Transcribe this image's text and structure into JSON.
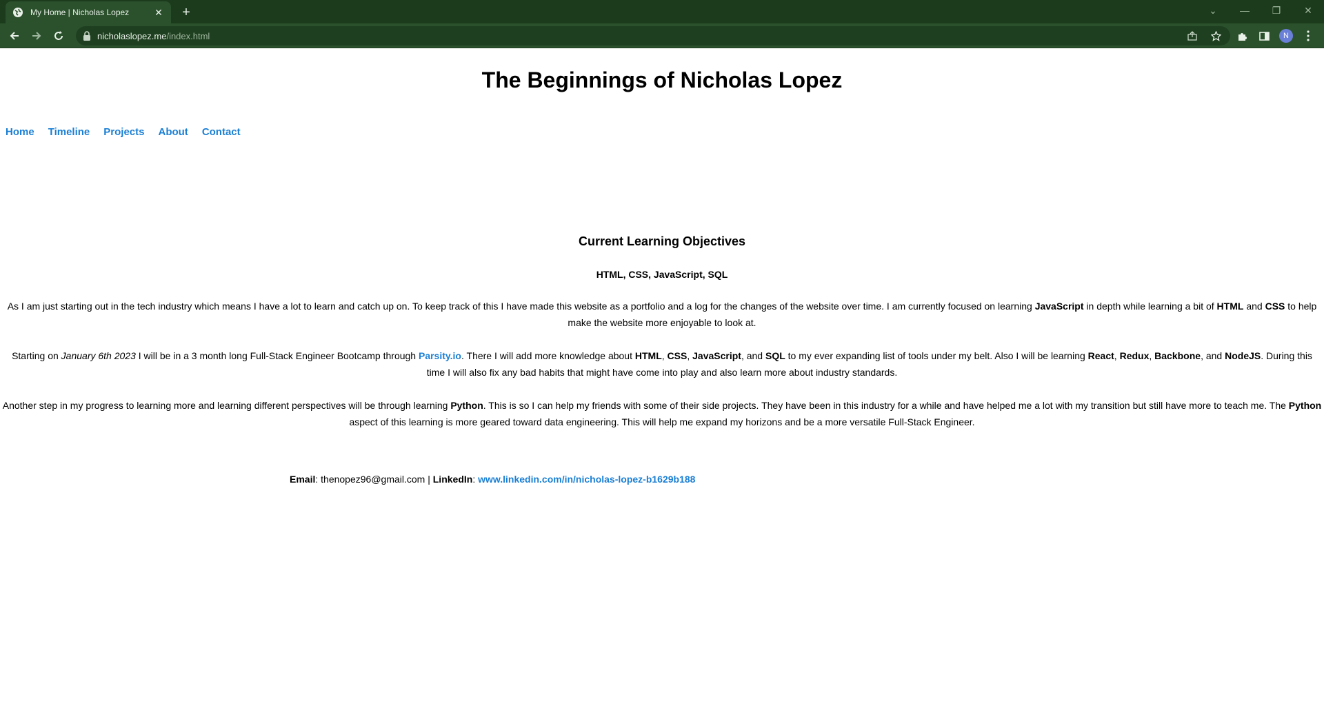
{
  "browser": {
    "tab_title": "My Home | Nicholas Lopez",
    "url_host": "nicholaslopez.me",
    "url_path": "/index.html",
    "profile_initial": "N",
    "theme_color": "#2b512c"
  },
  "site": {
    "title": "The Beginnings of Nicholas Lopez",
    "nav": [
      "Home",
      "Timeline",
      "Projects",
      "About",
      "Contact"
    ],
    "link_color": "#1a7fd4"
  },
  "objectives": {
    "heading": "Current Learning Objectives",
    "skills": "HTML, CSS, JavaScript, SQL",
    "p1": {
      "t1": "As I am just starting out in the tech industry which means I have a lot to learn and catch up on. To keep track of this I have made this website as a portfolio and a log for the changes of the website over time. I am currently focused on learning ",
      "b1": "JavaScript",
      "t2": " in depth while learning a bit of ",
      "b2": "HTML",
      "t3": " and ",
      "b3": "CSS",
      "t4": " to help make the website more enjoyable to look at."
    },
    "p2": {
      "t1": "Starting on ",
      "date": "January 6th 2023",
      "t2": " I will be in a 3 month long Full-Stack Engineer Bootcamp through ",
      "link": "Parsity.io",
      "t3": ". There I will add more knowledge about ",
      "b1": "HTML",
      "b2": "CSS",
      "b3": "JavaScript",
      "t4": ", and ",
      "b4": "SQL",
      "t5": " to my ever expanding list of tools under my belt. Also I will be learning ",
      "b5": "React",
      "b6": "Redux",
      "b7": "Backbone",
      "t6": ", and ",
      "b8": "NodeJS",
      "t7": ". During this time I will also fix any bad habits that might have come into play and also learn more about industry standards."
    },
    "p3": {
      "t1": "Another step in my progress to learning more and learning different perspectives will be through learning ",
      "b1": "Python",
      "t2": ". This is so I can help my friends with some of their side projects. They have been in this industry for a while and have helped me a lot with my transition but still have more to teach me. The ",
      "b2": "Python",
      "t3": " aspect of this learning is more geared toward data engineering. This will help me expand my horizons and be a more versatile Full-Stack Engineer."
    }
  },
  "contact": {
    "email_label": "Email",
    "email": ": thenopez96@gmail.com | ",
    "linkedin_label": "LinkedIn",
    "linkedin_sep": ": ",
    "linkedin_url": "www.linkedin.com/in/nicholas-lopez-b1629b188"
  }
}
